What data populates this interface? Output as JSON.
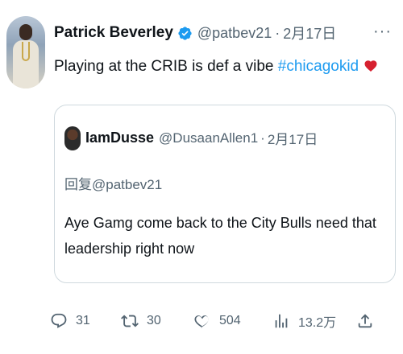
{
  "author": {
    "display_name": "Patrick Beverley",
    "handle": "@patbev21",
    "separator": "·",
    "time": "2月17日"
  },
  "tweet": {
    "text_before": "Playing at the CRIB is def a vibe ",
    "hashtag": "#chicagokid"
  },
  "menu": {
    "more_label": "···"
  },
  "quote": {
    "display_name": "IamDusse",
    "handle": "@DusaanAllen1",
    "separator": "·",
    "time": "2月17日",
    "reply_label": "回复",
    "reply_mention": "@patbev21",
    "body": "Aye Gamg come back to the City Bulls need that leadership right now"
  },
  "actions": {
    "replies": "31",
    "retweets": "30",
    "likes": "504",
    "views": "13.2万"
  },
  "colors": {
    "accent": "#1d9bf0",
    "muted": "#536471",
    "heart": "#d6202f"
  },
  "icons": [
    "verified-badge-icon",
    "heart-emoji-icon",
    "reply-icon",
    "retweet-icon",
    "like-icon",
    "views-icon",
    "share-icon",
    "more-icon"
  ]
}
